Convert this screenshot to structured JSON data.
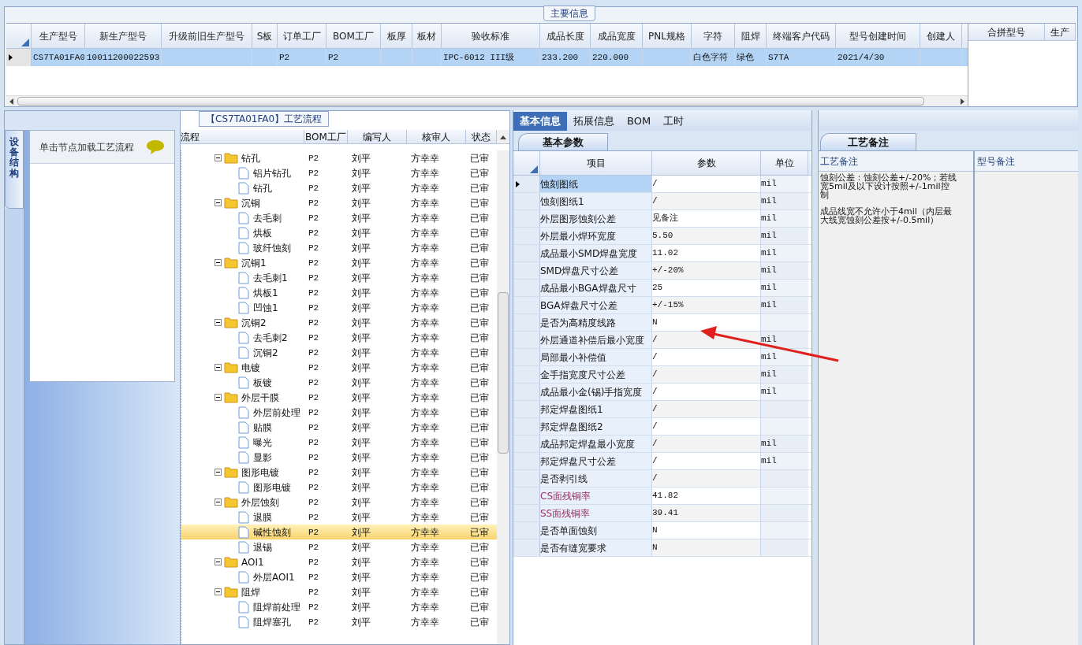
{
  "main_info": {
    "title": "主要信息",
    "columns": [
      "生产型号",
      "新生产型号",
      "升级前旧生产型号",
      "S板",
      "订单工厂",
      "BOM工厂",
      "板厚",
      "板材",
      "验收标准",
      "成品长度",
      "成品宽度",
      "PNL规格",
      "字符",
      "阻焊",
      "终端客户代码",
      "型号创建时间",
      "创建人"
    ],
    "rows": [
      {
        "selected": true,
        "cells": [
          "CS7TA01FA0",
          "10011200022593",
          "",
          "",
          "P2",
          "P2",
          "",
          "",
          "IPC-6012 III级",
          "233.200",
          "220.000",
          "",
          "白色字符",
          "绿色",
          "S7TA",
          "2021/4/30",
          ""
        ]
      }
    ],
    "side_columns": [
      "合拼型号",
      "生产"
    ]
  },
  "side_panel": {
    "tab": "设备结构",
    "hint": "单击节点加载工艺流程"
  },
  "flow": {
    "title": "【CS7TA01FA0】工艺流程",
    "columns": [
      "流程",
      "BOM工厂",
      "编写人",
      "核审人",
      "状态"
    ],
    "nodes": [
      {
        "name": "钻孔",
        "cells": [
          "P2",
          "刘平",
          "方幸幸",
          "已审"
        ],
        "selected": false,
        "expanded": true,
        "children": [
          {
            "name": "铝片钻孔",
            "cells": [
              "P2",
              "刘平",
              "方幸幸",
              "已审"
            ],
            "selected": false
          },
          {
            "name": "钻孔",
            "cells": [
              "P2",
              "刘平",
              "方幸幸",
              "已审"
            ],
            "selected": false
          }
        ]
      },
      {
        "name": "沉铜",
        "cells": [
          "P2",
          "刘平",
          "方幸幸",
          "已审"
        ],
        "selected": false,
        "expanded": true,
        "children": [
          {
            "name": "去毛刺",
            "cells": [
              "P2",
              "刘平",
              "方幸幸",
              "已审"
            ],
            "selected": false
          },
          {
            "name": "烘板",
            "cells": [
              "P2",
              "刘平",
              "方幸幸",
              "已审"
            ],
            "selected": false
          },
          {
            "name": "玻纤蚀刻",
            "cells": [
              "P2",
              "刘平",
              "方幸幸",
              "已审"
            ],
            "selected": false
          }
        ]
      },
      {
        "name": "沉铜1",
        "cells": [
          "P2",
          "刘平",
          "方幸幸",
          "已审"
        ],
        "selected": false,
        "expanded": true,
        "children": [
          {
            "name": "去毛刺1",
            "cells": [
              "P2",
              "刘平",
              "方幸幸",
              "已审"
            ],
            "selected": false
          },
          {
            "name": "烘板1",
            "cells": [
              "P2",
              "刘平",
              "方幸幸",
              "已审"
            ],
            "selected": false
          },
          {
            "name": "凹蚀1",
            "cells": [
              "P2",
              "刘平",
              "方幸幸",
              "已审"
            ],
            "selected": false
          }
        ]
      },
      {
        "name": "沉铜2",
        "cells": [
          "P2",
          "刘平",
          "方幸幸",
          "已审"
        ],
        "selected": false,
        "expanded": true,
        "children": [
          {
            "name": "去毛刺2",
            "cells": [
              "P2",
              "刘平",
              "方幸幸",
              "已审"
            ],
            "selected": false
          },
          {
            "name": "沉铜2",
            "cells": [
              "P2",
              "刘平",
              "方幸幸",
              "已审"
            ],
            "selected": false
          }
        ]
      },
      {
        "name": "电镀",
        "cells": [
          "P2",
          "刘平",
          "方幸幸",
          "已审"
        ],
        "selected": false,
        "expanded": true,
        "children": [
          {
            "name": "板镀",
            "cells": [
              "P2",
              "刘平",
              "方幸幸",
              "已审"
            ],
            "selected": false
          }
        ]
      },
      {
        "name": "外层干膜",
        "cells": [
          "P2",
          "刘平",
          "方幸幸",
          "已审"
        ],
        "selected": false,
        "expanded": true,
        "children": [
          {
            "name": "外层前处理",
            "cells": [
              "P2",
              "刘平",
              "方幸幸",
              "已审"
            ],
            "selected": false
          },
          {
            "name": "贴膜",
            "cells": [
              "P2",
              "刘平",
              "方幸幸",
              "已审"
            ],
            "selected": false
          },
          {
            "name": "曝光",
            "cells": [
              "P2",
              "刘平",
              "方幸幸",
              "已审"
            ],
            "selected": false
          },
          {
            "name": "显影",
            "cells": [
              "P2",
              "刘平",
              "方幸幸",
              "已审"
            ],
            "selected": false
          }
        ]
      },
      {
        "name": "图形电镀",
        "cells": [
          "P2",
          "刘平",
          "方幸幸",
          "已审"
        ],
        "selected": false,
        "expanded": true,
        "children": [
          {
            "name": "图形电镀",
            "cells": [
              "P2",
              "刘平",
              "方幸幸",
              "已审"
            ],
            "selected": false
          }
        ]
      },
      {
        "name": "外层蚀刻",
        "cells": [
          "P2",
          "刘平",
          "方幸幸",
          "已审"
        ],
        "selected": false,
        "expanded": true,
        "children": [
          {
            "name": "退膜",
            "cells": [
              "P2",
              "刘平",
              "方幸幸",
              "已审"
            ],
            "selected": false
          },
          {
            "name": "碱性蚀刻",
            "cells": [
              "P2",
              "刘平",
              "方幸幸",
              "已审"
            ],
            "selected": true
          },
          {
            "name": "退锡",
            "cells": [
              "P2",
              "刘平",
              "方幸幸",
              "已审"
            ],
            "selected": false
          }
        ]
      },
      {
        "name": "AOI1",
        "cells": [
          "P2",
          "刘平",
          "方幸幸",
          "已审"
        ],
        "selected": false,
        "expanded": true,
        "children": [
          {
            "name": "外层AOI1",
            "cells": [
              "P2",
              "刘平",
              "方幸幸",
              "已审"
            ],
            "selected": false
          }
        ]
      },
      {
        "name": "阻焊",
        "cells": [
          "P2",
          "刘平",
          "方幸幸",
          "已审"
        ],
        "selected": false,
        "expanded": true,
        "children": [
          {
            "name": "阻焊前处理",
            "cells": [
              "P2",
              "刘平",
              "方幸幸",
              "已审"
            ],
            "selected": false
          },
          {
            "name": "阻焊塞孔",
            "cells": [
              "P2",
              "刘平",
              "方幸幸",
              "已审"
            ],
            "selected": false
          }
        ]
      }
    ]
  },
  "detail_tabs": [
    {
      "label": "基本信息",
      "selected": true
    },
    {
      "label": "拓展信息",
      "selected": false
    },
    {
      "label": "BOM",
      "selected": false
    },
    {
      "label": "工时",
      "selected": false
    }
  ],
  "params": {
    "tab": "基本参数",
    "columns": [
      "项目",
      "参数",
      "单位"
    ],
    "rows": [
      {
        "item": "蚀刻图纸",
        "value": "/",
        "unit": "mil",
        "selected": true
      },
      {
        "item": "蚀刻图纸1",
        "value": "/",
        "unit": "mil",
        "selected": false
      },
      {
        "item": "外层图形蚀刻公差",
        "value": "见备注",
        "unit": "mil",
        "selected": false
      },
      {
        "item": "外层最小焊环宽度",
        "value": "5.50",
        "unit": "mil",
        "selected": false
      },
      {
        "item": "成品最小SMD焊盘宽度",
        "value": "11.02",
        "unit": "mil",
        "selected": false
      },
      {
        "item": "SMD焊盘尺寸公差",
        "value": "+/-20%",
        "unit": "mil",
        "selected": false
      },
      {
        "item": "成品最小BGA焊盘尺寸",
        "value": "25",
        "unit": "mil",
        "selected": false
      },
      {
        "item": "BGA焊盘尺寸公差",
        "value": "+/-15%",
        "unit": "mil",
        "selected": false
      },
      {
        "item": "是否为高精度线路",
        "value": "N",
        "unit": "",
        "selected": false
      },
      {
        "item": "外层通道补偿后最小宽度",
        "value": "/",
        "unit": "mil",
        "selected": false
      },
      {
        "item": "局部最小补偿值",
        "value": "/",
        "unit": "mil",
        "selected": false
      },
      {
        "item": "金手指宽度尺寸公差",
        "value": "/",
        "unit": "mil",
        "selected": false
      },
      {
        "item": "成品最小金(锡)手指宽度",
        "value": "/",
        "unit": "mil",
        "selected": false
      },
      {
        "item": "邦定焊盘图纸1",
        "value": "/",
        "unit": "",
        "selected": false
      },
      {
        "item": "邦定焊盘图纸2",
        "value": "/",
        "unit": "",
        "selected": false
      },
      {
        "item": "成品邦定焊盘最小宽度",
        "value": "/",
        "unit": "mil",
        "selected": false
      },
      {
        "item": "邦定焊盘尺寸公差",
        "value": "/",
        "unit": "mil",
        "selected": false
      },
      {
        "item": "是否剥引线",
        "value": "/",
        "unit": "",
        "selected": false
      },
      {
        "item": "CS面残铜率",
        "value": "41.82",
        "unit": "",
        "selected": false,
        "color": "#993366"
      },
      {
        "item": "SS面残铜率",
        "value": "39.41",
        "unit": "",
        "selected": false,
        "color": "#993366"
      },
      {
        "item": "是否单面蚀刻",
        "value": "N",
        "unit": "",
        "selected": false
      },
      {
        "item": "是否有缝宽要求",
        "value": "N",
        "unit": "",
        "selected": false
      }
    ]
  },
  "notes": {
    "tab": "工艺备注",
    "columns": [
      "工艺备注",
      "型号备注"
    ],
    "process_note": [
      "蚀刻公差：蚀刻公差+/-20%；若线宽5mil及以下设计按照+/-1mil控制",
      "成品线宽不允许小于4mil（内层最大线宽蚀刻公差按+/-0.5mil）"
    ]
  }
}
